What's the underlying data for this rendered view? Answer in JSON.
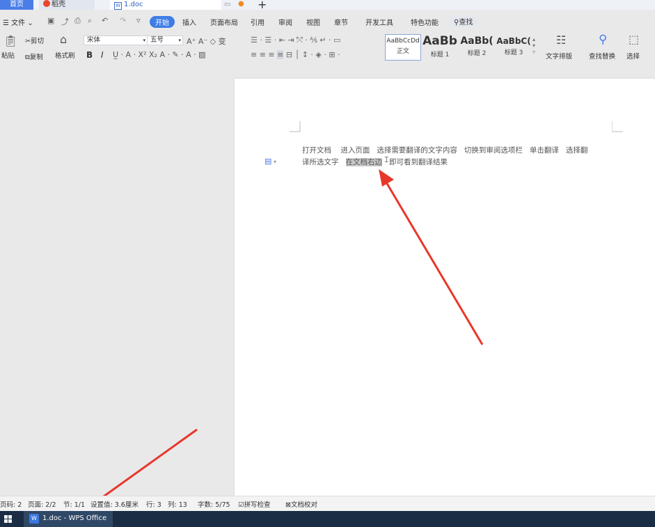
{
  "tabs": {
    "home": "首页",
    "daoke": "稻壳",
    "doc": "1.doc",
    "new_tab_icon": "plus-icon"
  },
  "menu": {
    "file": "文件",
    "items": [
      "插入",
      "页面布局",
      "引用",
      "审阅",
      "视图",
      "章节",
      "开发工具",
      "特色功能"
    ],
    "start": "开始",
    "search": "查找"
  },
  "ribbon": {
    "paste": "粘贴",
    "cut": "剪切",
    "copy": "复制",
    "format_painter": "格式刷",
    "font_name": "宋体",
    "font_size": "五号",
    "bold": "B",
    "italic": "I",
    "text_layout": "文字排版",
    "find_replace": "查找替换",
    "select": "选择",
    "styles": [
      {
        "preview": "AaBbCcDd",
        "label": "正文"
      },
      {
        "preview": "AaBb",
        "label": "标题 1"
      },
      {
        "preview": "AaBb(",
        "label": "标题 2"
      },
      {
        "preview": "AaBbC(",
        "label": "标题 3"
      }
    ]
  },
  "document": {
    "line1": "打开文档    进入页面   选择需要翻译的文字内容   切换到审阅选项栏   单击翻译   选择翻",
    "line2_prefix": "译所选文字   ",
    "line2_highlight": "在文档右边",
    "line2_suffix": "   即可看到翻译结果"
  },
  "status": {
    "page_code": "页码: 2",
    "pages": "页面: 2/2",
    "section": "节: 1/1",
    "position": "设置值: 3.6厘米",
    "row": "行: 3",
    "col": "列: 13",
    "words": "字数: 5/75",
    "spellcheck": "拼写检查",
    "doc_check": "文档校对"
  },
  "taskbar": {
    "app_label": "1.doc - WPS Office"
  },
  "colors": {
    "accent": "#3f7de6",
    "arrow": "#e8372a",
    "taskbar": "#1a2d44"
  }
}
